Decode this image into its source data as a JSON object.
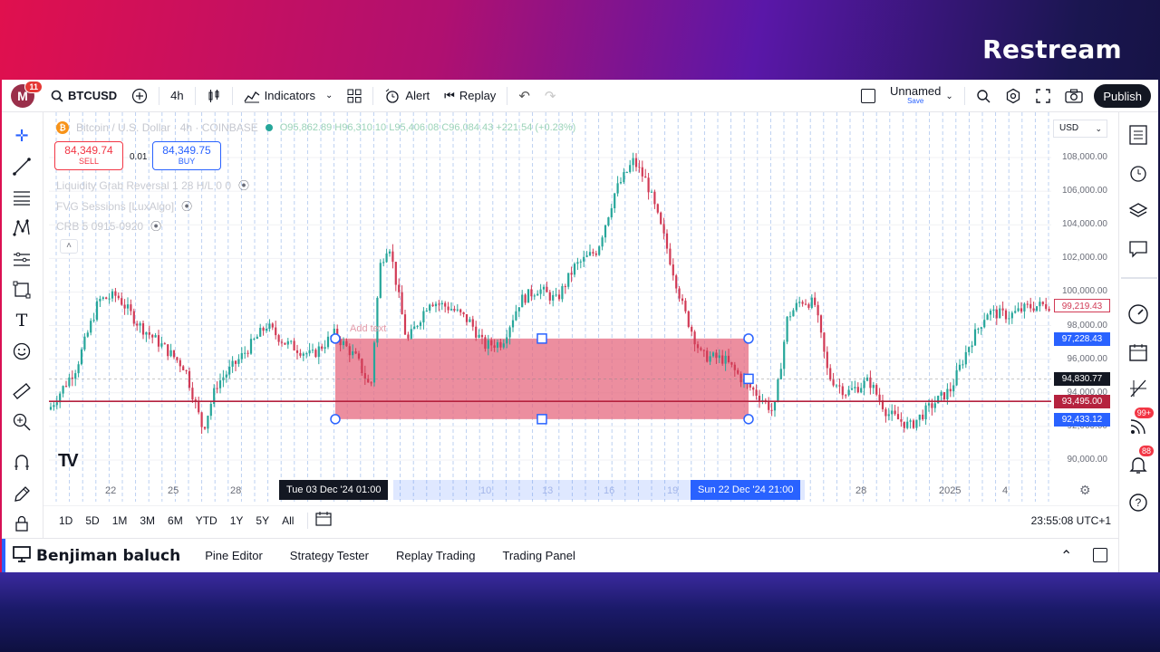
{
  "brand": "Restream",
  "topbar": {
    "logo_letter": "M",
    "logo_badge": "11",
    "symbol": "BTCUSD",
    "interval": "4h",
    "indicators": "Indicators",
    "alert": "Alert",
    "replay": "Replay",
    "layout_name": "Unnamed",
    "layout_save": "Save",
    "publish": "Publish"
  },
  "legend": {
    "title": "Bitcoin / U.S. Dollar · 4h · COINBASE",
    "ohlc": "O95,862.89 H96,310.10 L95,406.08 C96,084.43 +221.54 (+0.23%)"
  },
  "trade": {
    "sell_price": "84,349.74",
    "sell_label": "SELL",
    "buy_price": "84,349.75",
    "buy_label": "BUY",
    "spread": "0.01"
  },
  "indicators": [
    "Liquidity Grab Reversal 1 28 H/L 0 0",
    "FVG Sessions [LuxAlgo]",
    "CRB 5 0915-0920"
  ],
  "drawing_label": "Add text",
  "price_axis": {
    "currency": "USD",
    "labels": [
      "108,000.00",
      "106,000.00",
      "104,000.00",
      "102,000.00",
      "100,000.00",
      "98,000.00",
      "96,000.00",
      "94,000.00",
      "92,000.00",
      "90,000.00"
    ],
    "tags": [
      {
        "text": "99,219.43",
        "kind": "outline-red"
      },
      {
        "text": "97,228.43",
        "kind": "blue"
      },
      {
        "text": "94,830.77",
        "kind": "black"
      },
      {
        "text": "93,495.00",
        "kind": "red"
      },
      {
        "text": "92,433.12",
        "kind": "blue"
      }
    ]
  },
  "time_axis": {
    "labels": [
      "22",
      "25",
      "28",
      "10",
      "13",
      "16",
      "19",
      "28",
      "2025",
      "4"
    ],
    "range_start": "Tue 03 Dec '24   01:00",
    "range_end": "Sun 22 Dec '24   21:00"
  },
  "ranges": [
    "1D",
    "5D",
    "1M",
    "3M",
    "6M",
    "YTD",
    "1Y",
    "5Y",
    "All"
  ],
  "clock": "23:55:08 UTC+1",
  "panel": {
    "user": "Benjiman baluch",
    "tabs": [
      "Pine Editor",
      "Strategy Tester",
      "Replay Trading",
      "Trading Panel"
    ]
  },
  "right_badges": {
    "ideas": "99+",
    "notifications": "88"
  },
  "colors": {
    "up": "#26a69a",
    "down": "#d13a55",
    "zone": "#e5687f",
    "hline": "#b5223e",
    "accent": "#2962ff"
  },
  "chart_data": {
    "type": "candlestick",
    "symbol": "Bitcoin / U.S. Dollar",
    "interval": "4h",
    "exchange": "COINBASE",
    "ylim": [
      89500,
      109000
    ],
    "horizontal_line": 93495.0,
    "zone": {
      "top": 97228.43,
      "bottom": 92433.12,
      "start": "Tue 03 Dec '24 01:00",
      "end": "Sun 22 Dec '24 21:00"
    },
    "path": [
      [
        0,
        93000
      ],
      [
        30,
        95500
      ],
      [
        55,
        99500
      ],
      [
        75,
        99800
      ],
      [
        100,
        98000
      ],
      [
        125,
        96800
      ],
      [
        150,
        95500
      ],
      [
        170,
        91800
      ],
      [
        185,
        94500
      ],
      [
        210,
        96000
      ],
      [
        240,
        98000
      ],
      [
        260,
        97000
      ],
      [
        290,
        96200
      ],
      [
        315,
        97500
      ],
      [
        340,
        96000
      ],
      [
        355,
        94200
      ],
      [
        365,
        101500
      ],
      [
        375,
        103000
      ],
      [
        395,
        97000
      ],
      [
        420,
        99500
      ],
      [
        445,
        99000
      ],
      [
        465,
        98200
      ],
      [
        480,
        96800
      ],
      [
        500,
        97000
      ],
      [
        520,
        99500
      ],
      [
        540,
        100200
      ],
      [
        560,
        99500
      ],
      [
        580,
        101500
      ],
      [
        605,
        102500
      ],
      [
        625,
        106000
      ],
      [
        645,
        107800
      ],
      [
        660,
        106500
      ],
      [
        680,
        103000
      ],
      [
        700,
        99000
      ],
      [
        720,
        96200
      ],
      [
        745,
        96000
      ],
      [
        770,
        94500
      ],
      [
        790,
        93500
      ],
      [
        800,
        92800
      ],
      [
        815,
        98500
      ],
      [
        830,
        99500
      ],
      [
        845,
        99300
      ],
      [
        860,
        95000
      ],
      [
        880,
        94000
      ],
      [
        905,
        94700
      ],
      [
        925,
        92800
      ],
      [
        950,
        92000
      ],
      [
        975,
        93300
      ],
      [
        995,
        94200
      ],
      [
        1015,
        96800
      ],
      [
        1035,
        98800
      ],
      [
        1060,
        98600
      ],
      [
        1080,
        99100
      ],
      [
        1098,
        99219
      ]
    ]
  }
}
